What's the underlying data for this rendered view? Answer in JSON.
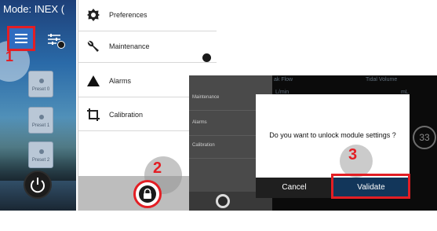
{
  "main_screen": {
    "mode_label": "Mode: INEX (",
    "presets": [
      "Preset 0",
      "Preset 1",
      "Preset 2"
    ]
  },
  "menu": {
    "items": [
      {
        "label": "Preferences",
        "icon": "brightness-icon"
      },
      {
        "label": "Maintenance",
        "icon": "wrench-icon"
      },
      {
        "label": "Alarms",
        "icon": "warning-triangle-icon"
      },
      {
        "label": "Calibration",
        "icon": "crop-icon"
      }
    ]
  },
  "dialog_screen": {
    "menu_items": [
      "Maintenance",
      "Alarms",
      "Calibration"
    ],
    "background_labels": [
      "ak Flow",
      "Tidal Volume",
      "L/min",
      "mL"
    ],
    "gauge_value": "33",
    "question": "Do you want to unlock module settings ?",
    "cancel_label": "Cancel",
    "validate_label": "Validate"
  },
  "steps": [
    "1",
    "2",
    "3"
  ],
  "colors": {
    "annotation": "#e31e24",
    "menu_button": "#2f6cc0",
    "validate_button": "#12365a"
  }
}
